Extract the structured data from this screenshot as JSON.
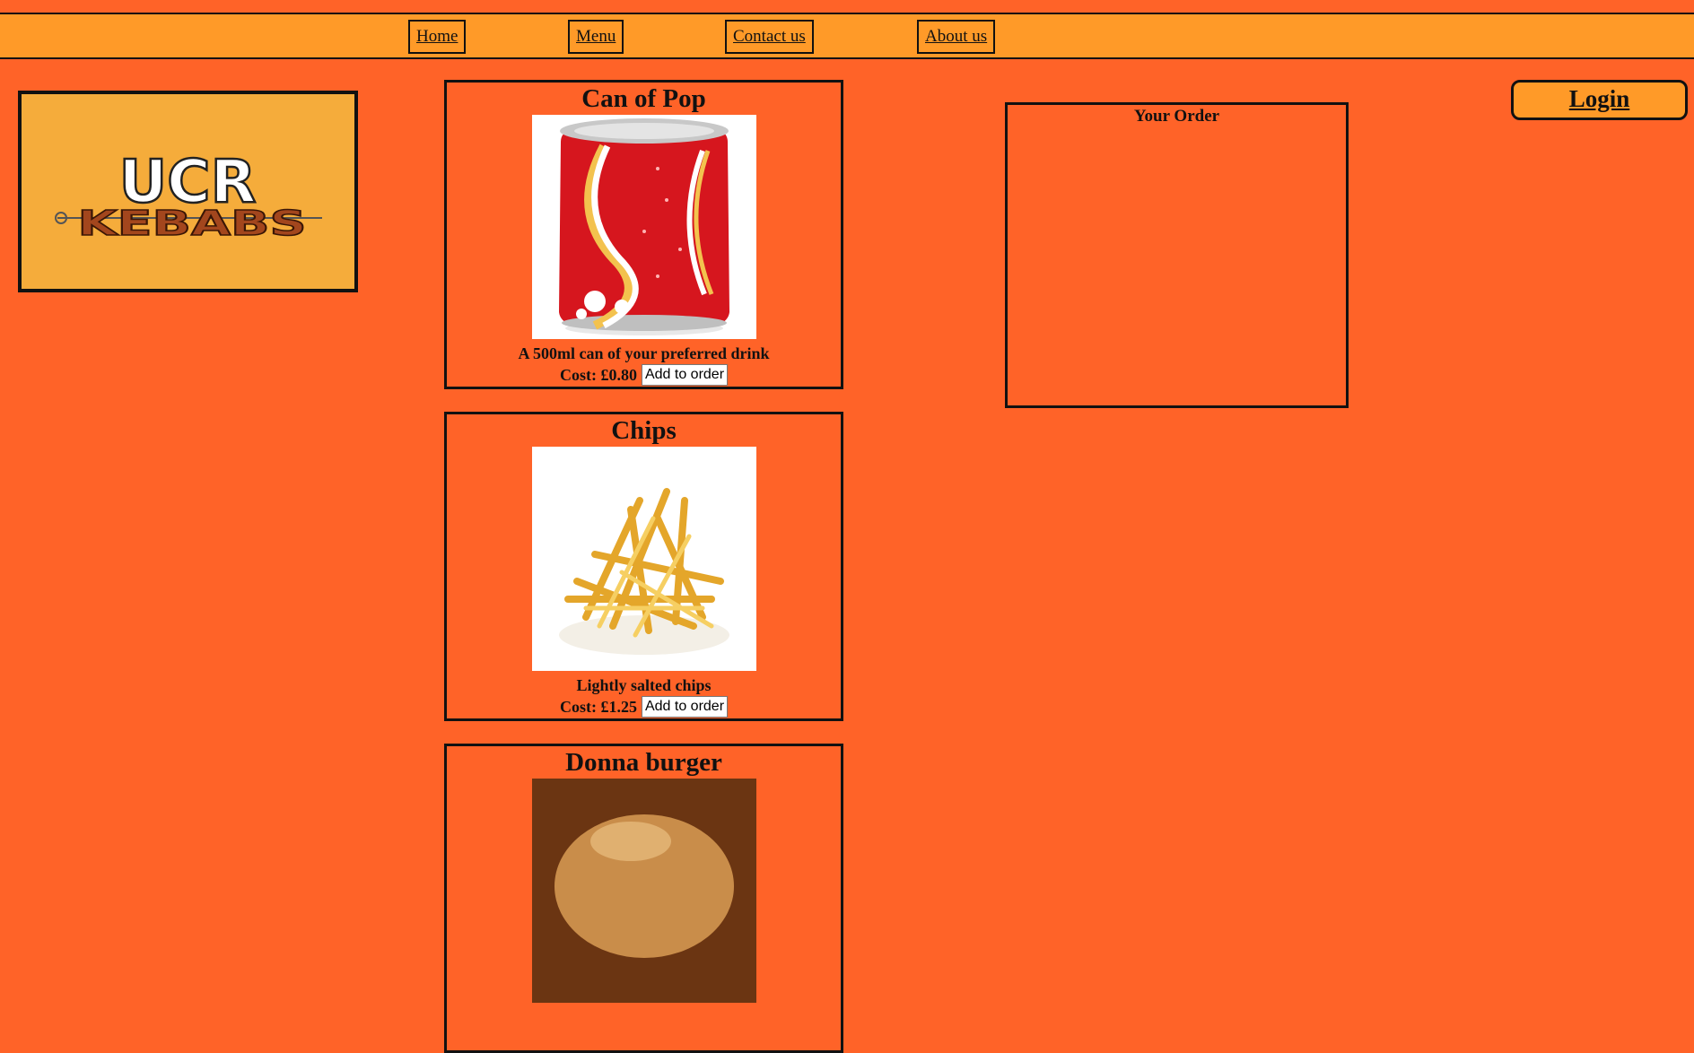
{
  "nav": {
    "home": "Home",
    "menu": "Menu",
    "contact": "Contact us",
    "about": "About us"
  },
  "logo": {
    "line1": "UCR",
    "line2": "KEBABS"
  },
  "login": "Login",
  "order": {
    "title": "Your Order"
  },
  "products": [
    {
      "name": "Can of Pop",
      "description": "A 500ml can of your preferred drink",
      "cost": "Cost: £0.80",
      "button": "Add to order"
    },
    {
      "name": "Chips",
      "description": "Lightly salted chips",
      "cost": "Cost: £1.25",
      "button": "Add to order"
    },
    {
      "name": "Donna burger"
    }
  ],
  "colors": {
    "background": "#ff6328",
    "nav": "#ff9a28",
    "logo_bg": "#f5ac3b"
  }
}
